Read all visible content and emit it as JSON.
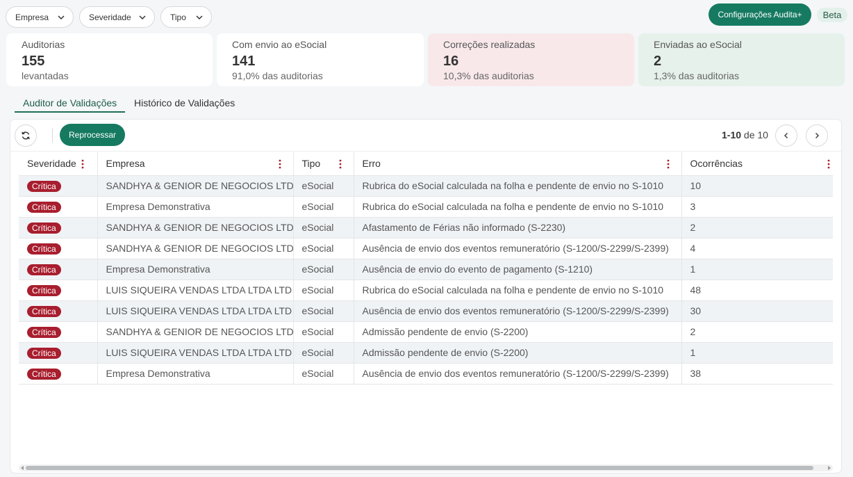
{
  "filters": [
    {
      "label": "Empresa"
    },
    {
      "label": "Severidade"
    },
    {
      "label": "Tipo"
    }
  ],
  "config_button": "Configurações Audita+",
  "beta": "Beta",
  "cards": [
    {
      "label": "Auditorias",
      "value": "155",
      "sub": "levantadas",
      "bg": "#ffffff"
    },
    {
      "label": "Com envio ao eSocial",
      "value": "141",
      "sub": "91,0% das auditorias",
      "bg": "#ffffff"
    },
    {
      "label": "Correções realizadas",
      "value": "16",
      "sub": "10,3% das auditorias",
      "bg": "#f8e8ea"
    },
    {
      "label": "Enviadas ao eSocial",
      "value": "2",
      "sub": "1,3% das auditorias",
      "bg": "#e6f1ec"
    }
  ],
  "tabs": {
    "active": "Auditor de Validações",
    "inactive": "Histórico de Validações"
  },
  "toolbar": {
    "reprocess": "Reprocessar",
    "page_range": "1-10",
    "page_of": "de 10"
  },
  "table": {
    "headers": [
      "Severidade",
      "Empresa",
      "Tipo",
      "Erro",
      "Ocorrências"
    ],
    "rows": [
      {
        "severidade": "Crítica",
        "empresa": "SANDHYA & GENIOR DE NEGOCIOS LTDA",
        "tipo": "eSocial",
        "erro": "Rubrica do eSocial calculada na folha e pendente de envio no S-1010",
        "ocorrencias": "10"
      },
      {
        "severidade": "Crítica",
        "empresa": "Empresa Demonstrativa",
        "tipo": "eSocial",
        "erro": "Rubrica do eSocial calculada na folha e pendente de envio no S-1010",
        "ocorrencias": "3"
      },
      {
        "severidade": "Crítica",
        "empresa": "SANDHYA & GENIOR DE NEGOCIOS LTDA",
        "tipo": "eSocial",
        "erro": "Afastamento de Férias não informado (S-2230)",
        "ocorrencias": "2"
      },
      {
        "severidade": "Crítica",
        "empresa": "SANDHYA & GENIOR DE NEGOCIOS LTDA",
        "tipo": "eSocial",
        "erro": "Ausência de envio dos eventos remuneratório (S-1200/S-2299/S-2399)",
        "ocorrencias": "4"
      },
      {
        "severidade": "Crítica",
        "empresa": "Empresa Demonstrativa",
        "tipo": "eSocial",
        "erro": "Ausência de envio do evento de pagamento (S-1210)",
        "ocorrencias": "1"
      },
      {
        "severidade": "Crítica",
        "empresa": "LUIS SIQUEIRA VENDAS LTDA LTDA LTD",
        "tipo": "eSocial",
        "erro": "Rubrica do eSocial calculada na folha e pendente de envio no S-1010",
        "ocorrencias": "48"
      },
      {
        "severidade": "Crítica",
        "empresa": "LUIS SIQUEIRA VENDAS LTDA LTDA LTD",
        "tipo": "eSocial",
        "erro": "Ausência de envio dos eventos remuneratório (S-1200/S-2299/S-2399)",
        "ocorrencias": "30"
      },
      {
        "severidade": "Crítica",
        "empresa": "SANDHYA & GENIOR DE NEGOCIOS LTDA",
        "tipo": "eSocial",
        "erro": "Admissão pendente de envio (S-2200)",
        "ocorrencias": "2"
      },
      {
        "severidade": "Crítica",
        "empresa": "LUIS SIQUEIRA VENDAS LTDA LTDA LTD",
        "tipo": "eSocial",
        "erro": "Admissão pendente de envio (S-2200)",
        "ocorrencias": "1"
      },
      {
        "severidade": "Crítica",
        "empresa": "Empresa Demonstrativa",
        "tipo": "eSocial",
        "erro": "Ausência de envio dos eventos remuneratório (S-1200/S-2299/S-2399)",
        "ocorrencias": "38"
      }
    ]
  },
  "colors": {
    "primary": "#167a61",
    "critical": "#a81e2e",
    "kebab": "#a81e2e"
  }
}
